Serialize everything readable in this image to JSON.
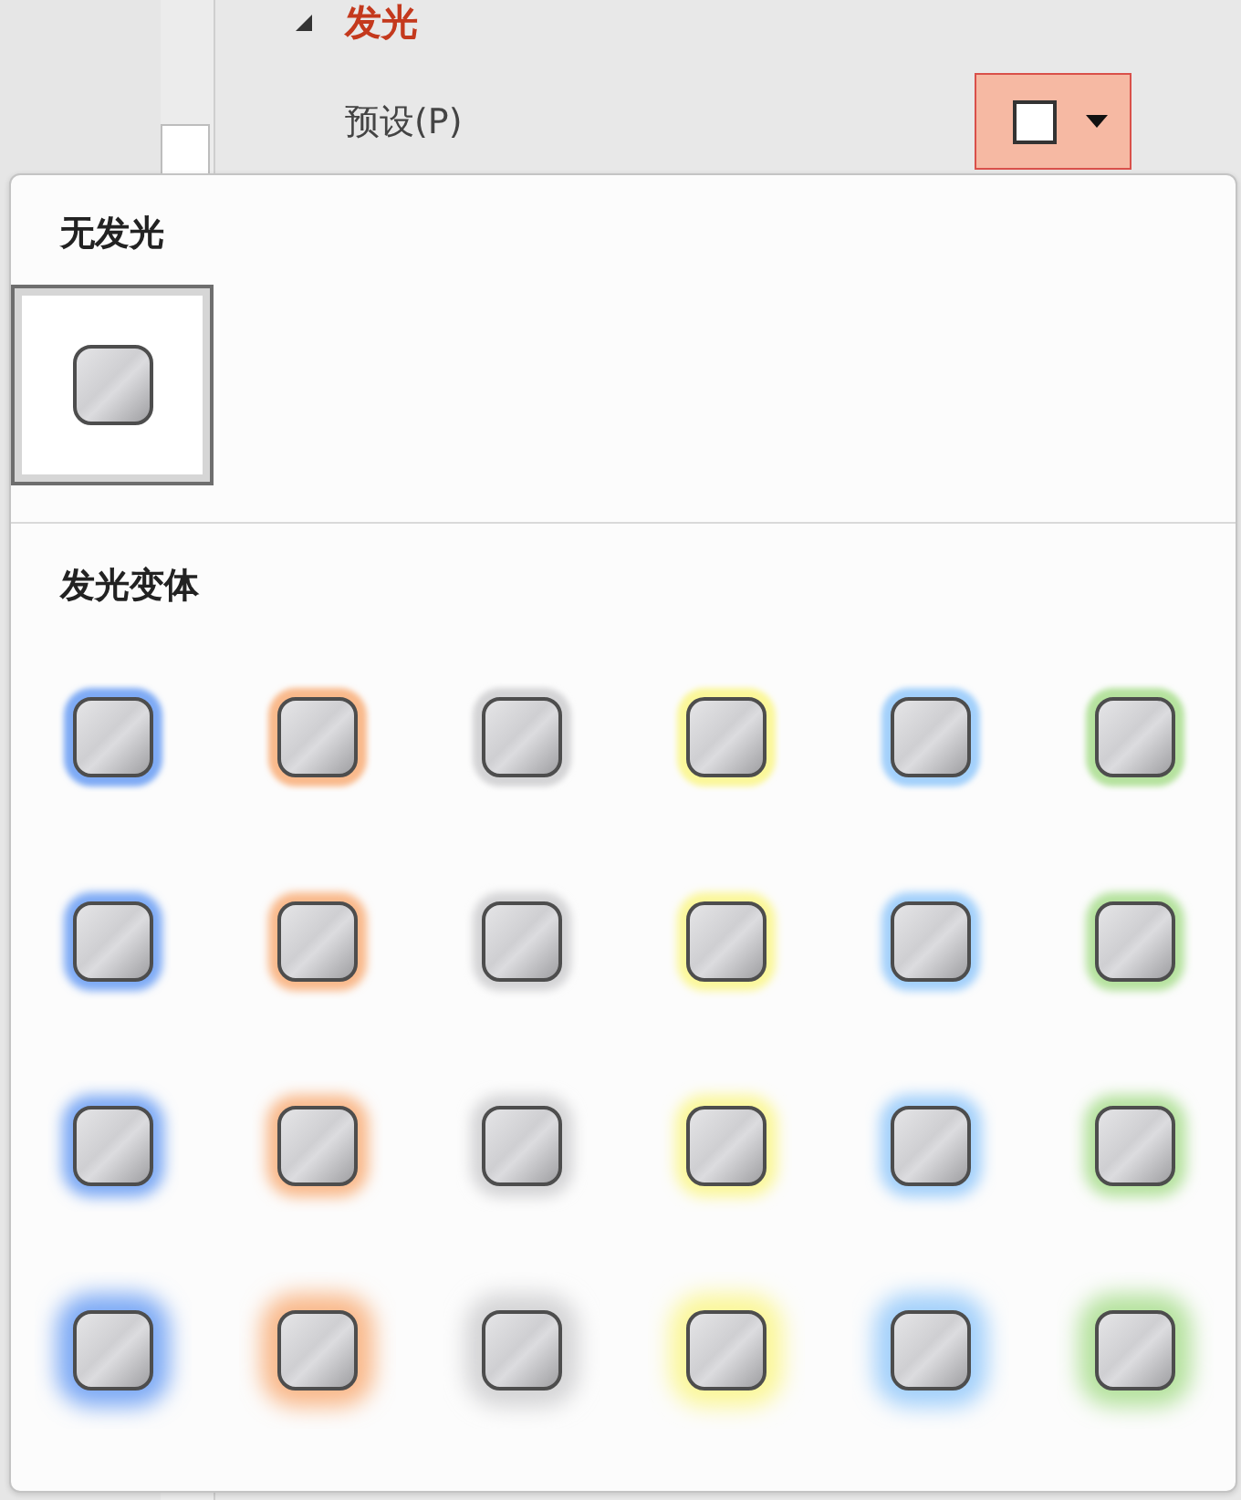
{
  "section": {
    "title": "发光",
    "expanded": true
  },
  "preset": {
    "label": "预设(P)",
    "dropdown_open": true
  },
  "no_glow": {
    "title": "无发光",
    "options": [
      {
        "selected": true
      }
    ]
  },
  "glow_variants": {
    "title": "发光变体",
    "rows": [
      [
        {
          "color": "#7eaaf5",
          "selected": false
        },
        {
          "color": "#f9b98b",
          "selected": false
        },
        {
          "color": "#d4d4d6",
          "selected": false
        },
        {
          "color": "#fbf79a",
          "selected": false
        },
        {
          "color": "#a3d0fb",
          "selected": false
        },
        {
          "color": "#b5e29e",
          "selected": false
        }
      ],
      [
        {
          "color": "#7eaaf5",
          "selected": false
        },
        {
          "color": "#f9b98b",
          "selected": false
        },
        {
          "color": "#d4d4d6",
          "selected": false
        },
        {
          "color": "#fbf79a",
          "selected": false
        },
        {
          "color": "#a3d0fb",
          "selected": false
        },
        {
          "color": "#b5e29e",
          "selected": false
        }
      ],
      [
        {
          "color": "#7eaaf5",
          "selected": false
        },
        {
          "color": "#f9b98b",
          "selected": false
        },
        {
          "color": "#d4d4d6",
          "selected": false
        },
        {
          "color": "#fbf79a",
          "selected": false
        },
        {
          "color": "#a3d0fb",
          "selected": false
        },
        {
          "color": "#b5e29e",
          "selected": false
        }
      ],
      [
        {
          "color": "#7eaaf5",
          "selected": false
        },
        {
          "color": "#f9b98b",
          "selected": false
        },
        {
          "color": "#d4d4d6",
          "selected": false
        },
        {
          "color": "#fbf79a",
          "selected": false
        },
        {
          "color": "#a3d0fb",
          "selected": false
        },
        {
          "color": "#b5e29e",
          "selected": false
        }
      ]
    ]
  }
}
